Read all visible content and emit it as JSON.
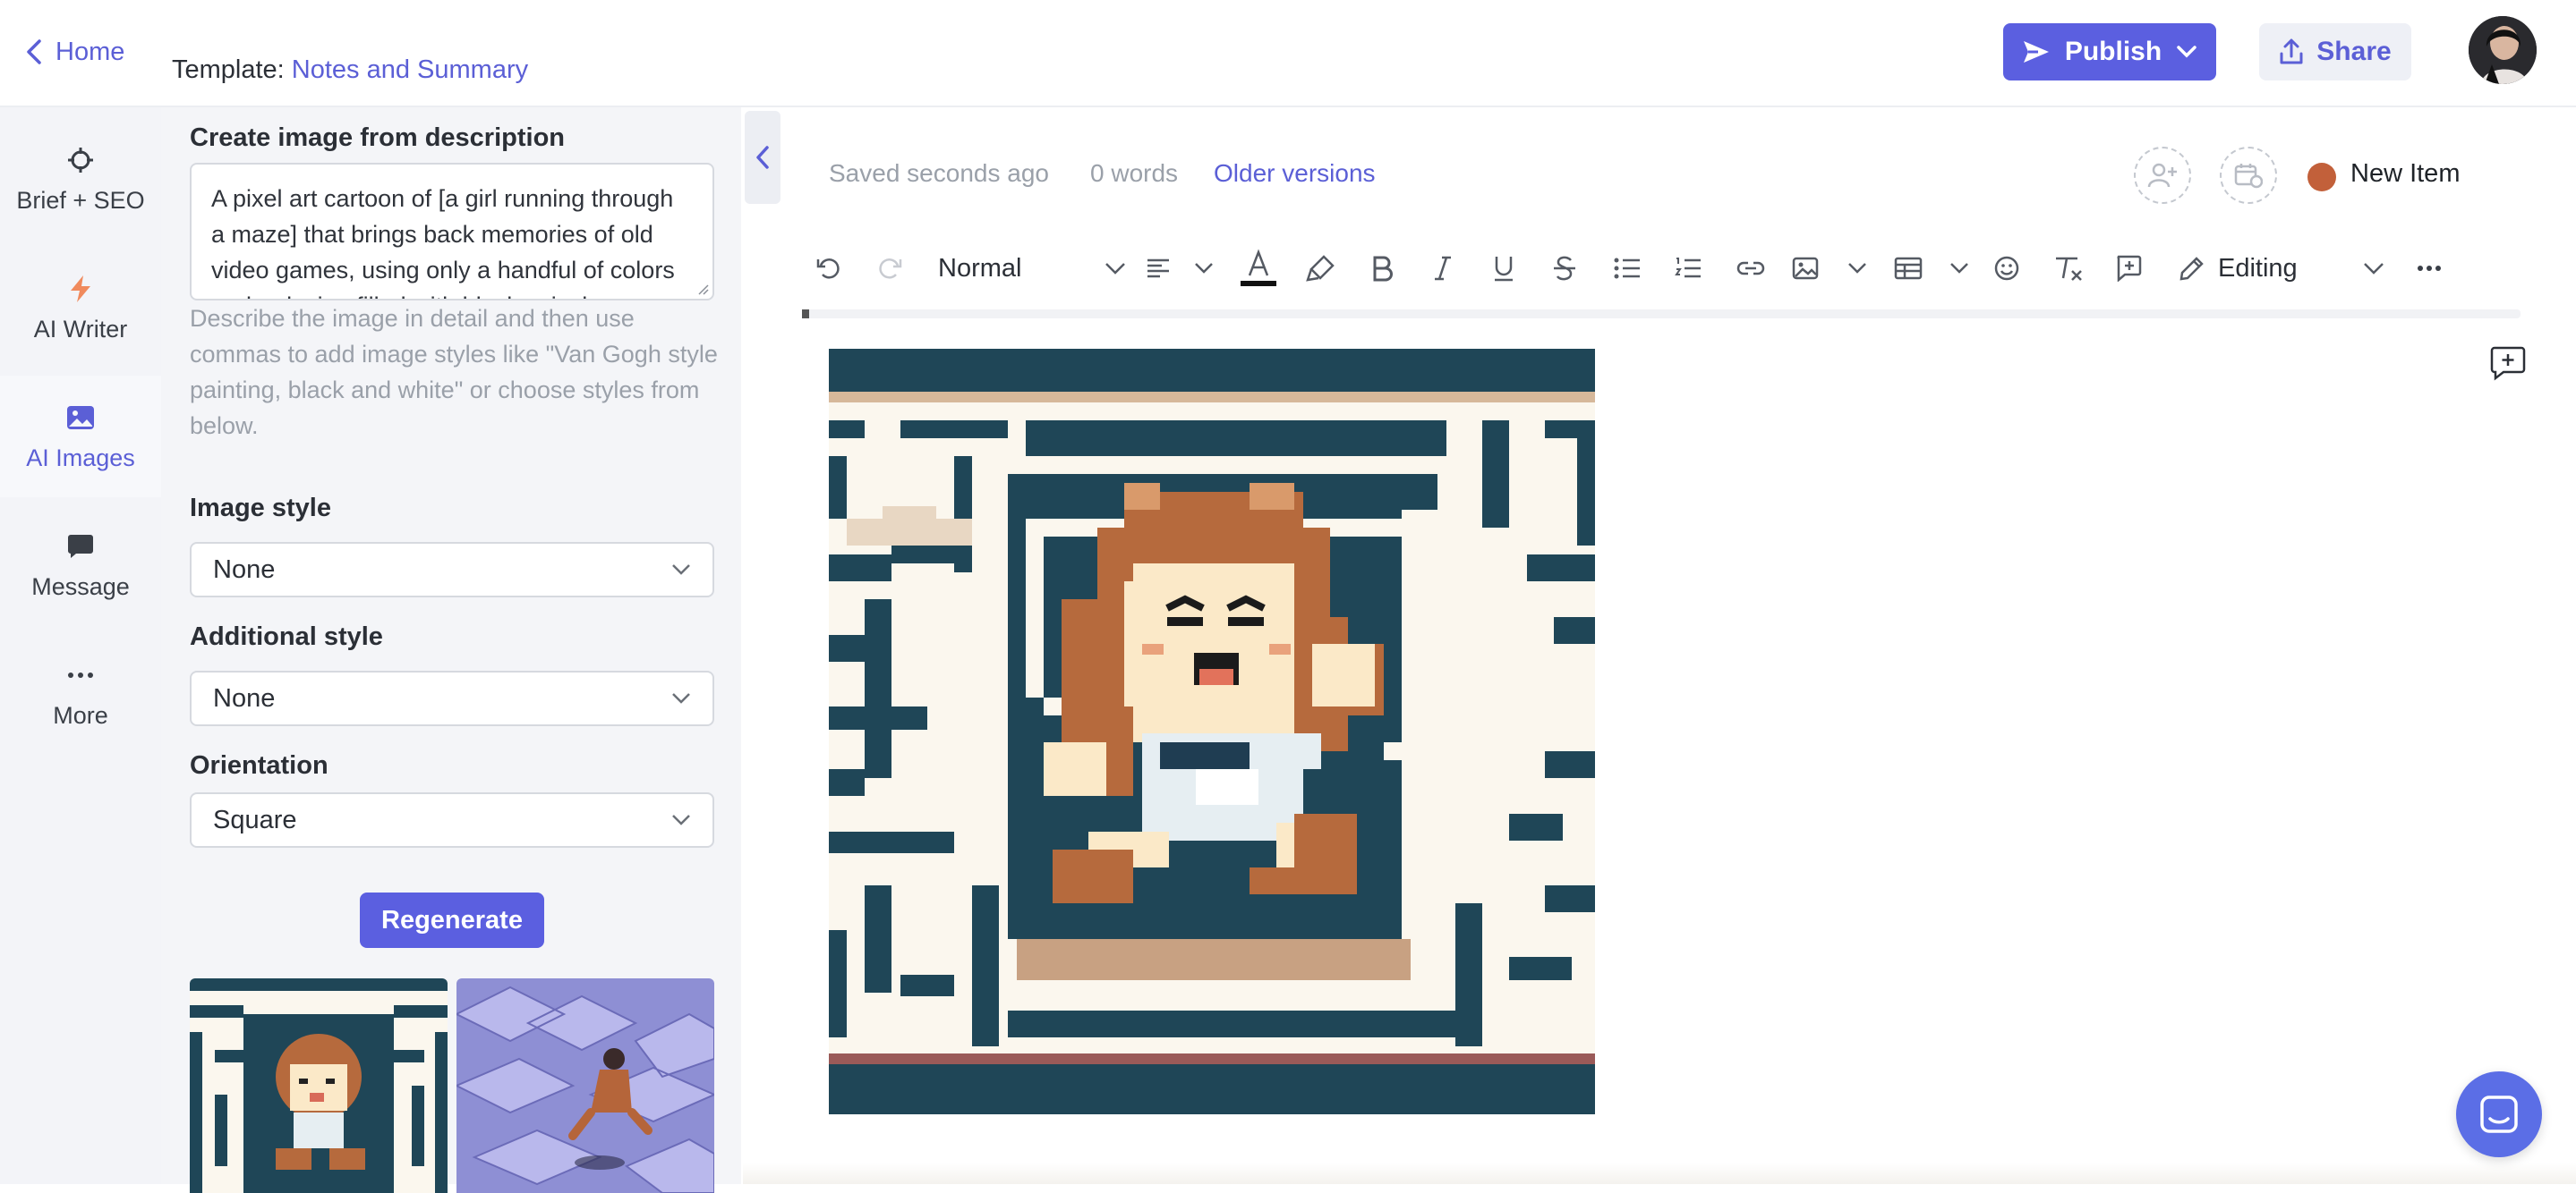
{
  "header": {
    "home_label": "Home",
    "template_prefix": "Template: ",
    "template_name": "Notes and Summary",
    "publish_label": "Publish",
    "share_label": "Share"
  },
  "rail": {
    "items": [
      {
        "label": "Brief + SEO",
        "icon": "crosshair-icon"
      },
      {
        "label": "AI Writer",
        "icon": "lightning-icon"
      },
      {
        "label": "AI Images",
        "icon": "image-icon",
        "active": true
      },
      {
        "label": "Message",
        "icon": "message-icon"
      },
      {
        "label": "More",
        "icon": "more-icon"
      }
    ]
  },
  "panel": {
    "create_label": "Create image from description",
    "description": "A pixel art cartoon of [a girl running through a maze] that brings back memories of old video games, using only a handful of colors and a design filled with blocky pixels.",
    "hint": "Describe the image in detail and then use commas to add image styles like \"Van Gogh style painting, black and white\" or choose styles from below.",
    "image_style_label": "Image style",
    "image_style_value": "None",
    "additional_style_label": "Additional style",
    "additional_style_value": "None",
    "orientation_label": "Orientation",
    "orientation_value": "Square",
    "regenerate_label": "Regenerate"
  },
  "editor": {
    "saved": "Saved seconds ago",
    "words": "0 words",
    "older_versions": "Older versions",
    "status": "New Item",
    "status_color": "#c2603a",
    "text_style": "Normal",
    "mode": "Editing"
  },
  "colors": {
    "accent": "#5b5fe0",
    "maze_dark": "#1f4657",
    "maze_light": "#fbf7ee"
  }
}
